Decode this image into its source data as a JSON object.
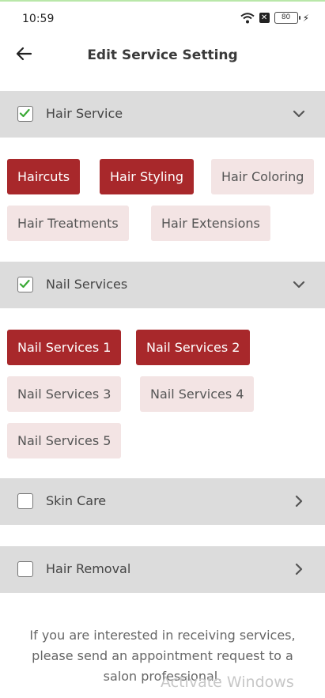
{
  "status": {
    "time": "10:59",
    "battery": "80"
  },
  "header": {
    "title": "Edit Service Setting"
  },
  "sections": [
    {
      "label": "Hair Service",
      "checked": true,
      "expanded": true,
      "chips": [
        {
          "label": "Haircuts",
          "selected": true
        },
        {
          "label": "Hair Styling",
          "selected": true
        },
        {
          "label": "Hair Coloring",
          "selected": false
        },
        {
          "label": "Hair Treatments",
          "selected": false
        },
        {
          "label": "Hair Extensions",
          "selected": false
        }
      ]
    },
    {
      "label": "Nail Services",
      "checked": true,
      "expanded": true,
      "chips": [
        {
          "label": "Nail Services 1",
          "selected": true
        },
        {
          "label": "Nail Services 2",
          "selected": true
        },
        {
          "label": "Nail Services 3",
          "selected": false
        },
        {
          "label": "Nail Services 4",
          "selected": false
        },
        {
          "label": "Nail Services 5",
          "selected": false
        }
      ]
    },
    {
      "label": "Skin Care",
      "checked": false,
      "expanded": false,
      "chips": []
    },
    {
      "label": "Hair Removal",
      "checked": false,
      "expanded": false,
      "chips": []
    }
  ],
  "footer": {
    "text": "If you are interested in receiving services, please send an appointment request to a salon professional."
  },
  "watermark": {
    "text": "Activate Windows"
  },
  "colors": {
    "selected_chip": "#a8282b",
    "unselected_chip": "#f3e4e4",
    "section_bg": "#dcdcdc",
    "checkmark": "#3aa935"
  }
}
